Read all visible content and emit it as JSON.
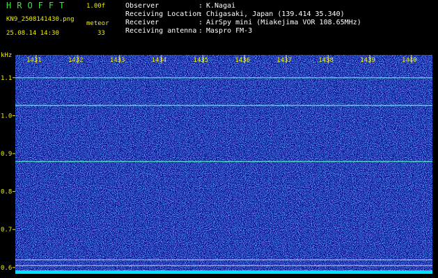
{
  "header": {
    "logo": "HROFFT",
    "version": "1.00f",
    "filename": "KN9_2508141430.png",
    "mode": "meteor",
    "datetime": "25.08.14 14:30",
    "count": "33"
  },
  "info": {
    "labels": [
      "Observer",
      "Receiving Location",
      "Receiver",
      "Receiving antenna"
    ],
    "values": [
      "K.Nagai",
      "Chigasaki, Japan (139.414 35.340)",
      "AirSpy mini (Miakejima VOR 108.65MHz)",
      "Maspro FM-3"
    ]
  },
  "colors": {
    "background": "#0a0a8c",
    "noise": "#1a5aff",
    "signal": "#5af0c8",
    "label": "#f0f000",
    "baseline": "#00e0ff"
  },
  "chart_data": {
    "type": "heatmap",
    "ylabel": "kHz",
    "x_ticks": [
      "1431",
      "1432",
      "1433",
      "1434",
      "1435",
      "1436",
      "1437",
      "1438",
      "1439",
      "1440"
    ],
    "x_range": [
      1430.5,
      1440.5
    ],
    "y_ticks": [
      "1.1",
      "1.0",
      "0.9",
      "0.8",
      "0.7",
      "0.6"
    ],
    "y_range": [
      0.585,
      1.16
    ],
    "carriers_khz": [
      1.1,
      1.027,
      0.879
    ],
    "reference_lines_khz": [
      0.62,
      0.605
    ]
  }
}
